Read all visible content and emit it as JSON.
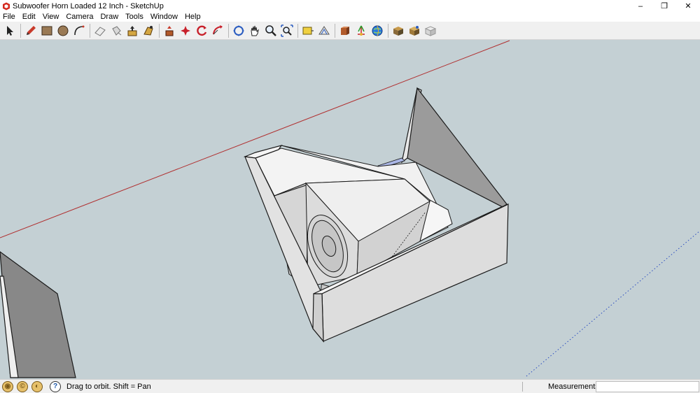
{
  "window": {
    "title": "Subwoofer Horn Loaded 12 Inch - SketchUp",
    "minimize": "–",
    "restore": "❐",
    "close": "✕"
  },
  "menu": [
    "File",
    "Edit",
    "View",
    "Camera",
    "Draw",
    "Tools",
    "Window",
    "Help"
  ],
  "toolbar": {
    "tools": [
      "select-icon",
      "pencil-icon",
      "rectangle-icon",
      "circle-icon",
      "arc-icon",
      "eraser-icon",
      "paint-bucket-icon",
      "push-pull-icon",
      "follow-me-icon",
      "move-icon",
      "rotate-icon",
      "offset-icon",
      "scale-icon",
      "orbit-icon",
      "pan-icon",
      "zoom-icon",
      "zoom-extents-icon",
      "tape-measure-icon",
      "protractor-icon",
      "axes-icon",
      "dimensions-icon",
      "3d-warehouse-icon",
      "components-icon",
      "extension-warehouse-icon",
      "get-models-icon",
      "share-model-icon",
      "layout-icon"
    ]
  },
  "statusbar": {
    "hint": "Drag to orbit.  Shift = Pan",
    "measurements_label": "Measurements",
    "measurements_value": ""
  },
  "colors": {
    "sky": "#c4d0d4",
    "face_light": "#eeeeee",
    "face_mid": "#d8d8d8",
    "face_dark": "#9a9a9a",
    "edge": "#1a1a1a",
    "red_axis": "#b03030",
    "blue_axis": "#2a4cc0"
  }
}
